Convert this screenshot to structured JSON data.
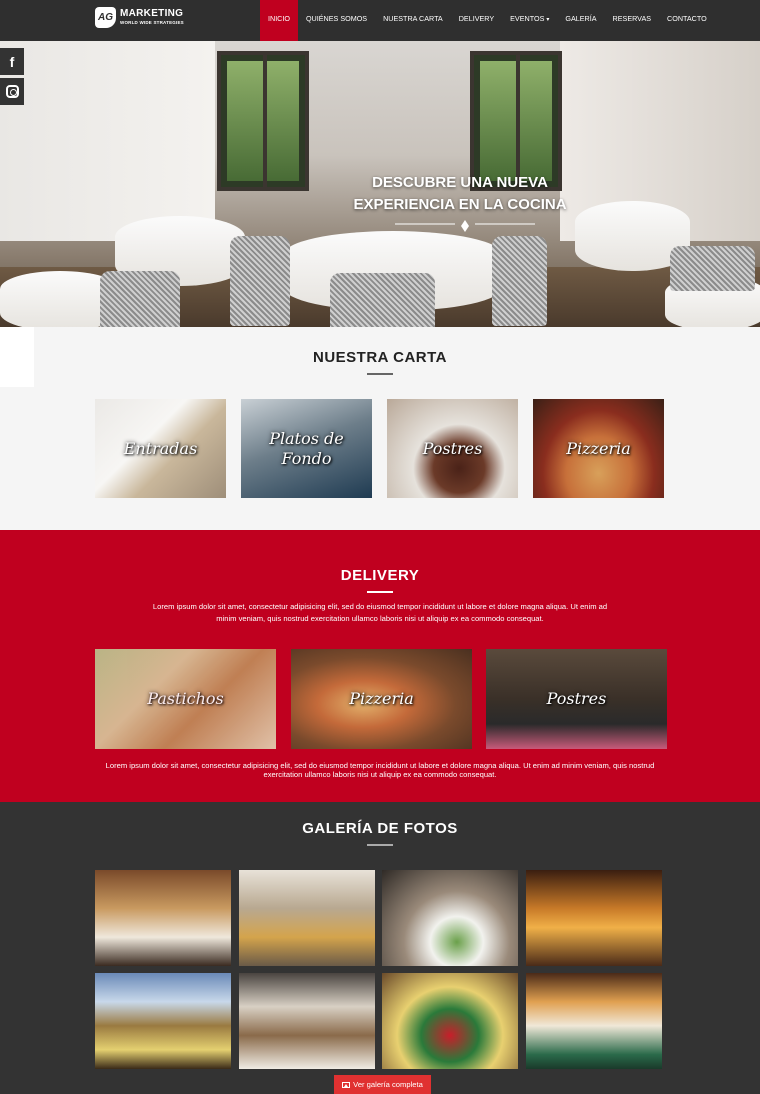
{
  "brand": {
    "badge": "AG",
    "title": "MARKETING",
    "subtitle": "WORLD WIDE STRATEGIES"
  },
  "nav": {
    "items": [
      {
        "label": "INICIO",
        "active": true
      },
      {
        "label": "QUIÉNES SOMOS",
        "active": false
      },
      {
        "label": "NUESTRA CARTA",
        "active": false
      },
      {
        "label": "DELIVERY",
        "active": false
      },
      {
        "label": "EVENTOS",
        "active": false,
        "dropdown": true
      },
      {
        "label": "GALERÍA",
        "active": false
      },
      {
        "label": "RESERVAS",
        "active": false
      },
      {
        "label": "CONTACTO",
        "active": false
      }
    ],
    "chevron": "▾"
  },
  "social": {
    "facebook_glyph": "f",
    "icons": [
      "facebook-icon",
      "instagram-icon"
    ]
  },
  "hero": {
    "title_line1": "DESCUBRE UNA NUEVA",
    "title_line2": "EXPERIENCIA EN LA COCINA"
  },
  "carta": {
    "title": "NUESTRA CARTA",
    "cards": [
      {
        "label": "Entradas"
      },
      {
        "label": "Platos de Fondo"
      },
      {
        "label": "Postres"
      },
      {
        "label": "Pizzeria"
      }
    ]
  },
  "delivery": {
    "title": "DELIVERY",
    "intro": "Lorem ipsum dolor sit amet, consectetur adipisicing elit, sed do eiusmod tempor incididunt ut labore et dolore magna aliqua. Ut enim ad minim veniam, quis nostrud exercitation ullamco laboris nisi ut aliquip ex ea commodo consequat.",
    "cards": [
      {
        "label": "Pastichos"
      },
      {
        "label": "Pizzeria"
      },
      {
        "label": "Postres"
      }
    ],
    "outro": "Lorem ipsum dolor sit amet, consectetur adipisicing elit, sed do eiusmod tempor incididunt ut labore et dolore magna aliqua. Ut enim ad minim veniam, quis nostrud exercitation ullamco laboris nisi ut aliquip ex ea commodo consequat."
  },
  "galeria": {
    "title": "GALERÍA DE FOTOS",
    "button_label": "Ver galería completa"
  },
  "colors": {
    "accent": "#c0001f",
    "navbar": "#2f2f2f",
    "button": "#e03131"
  }
}
